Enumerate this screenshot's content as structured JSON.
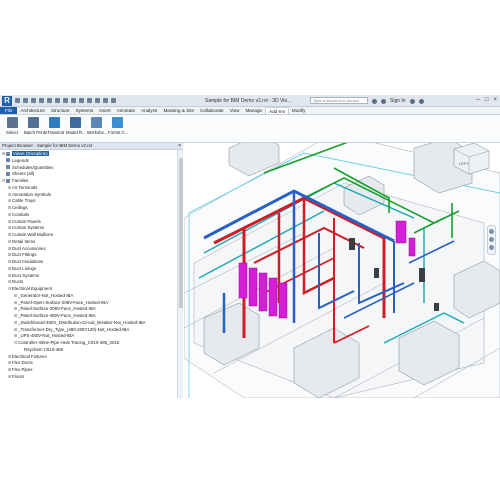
{
  "titlebar": {
    "logo": "R",
    "window_title": "Sample for BIM Demo v2.rvt - 3D Vie...",
    "search_placeholder": "Type a keyword or phrase",
    "sign_in": "Sign In"
  },
  "ribbon_tabs": [
    "File",
    "Architecture",
    "Structure",
    "Systems",
    "Insert",
    "Annotate",
    "Analyze",
    "Massing & Site",
    "Collaborate",
    "View",
    "Manage",
    "Add-Ins",
    "Modify"
  ],
  "active_tab": "Add-Ins",
  "ribbon_buttons": [
    {
      "label": "Select",
      "icon": "cursor-icon",
      "color": "#5d7390"
    },
    {
      "label": "Batch Print",
      "icon": "printer-icon",
      "color": "#4f6f95"
    },
    {
      "label": "eTransmit",
      "icon": "etransmit-icon",
      "color": "#2f7cc0"
    },
    {
      "label": "Model R...",
      "icon": "model-review-icon",
      "color": "#3d6aa0"
    },
    {
      "label": "Workshe...",
      "icon": "worksharing-icon",
      "color": "#5b86b8"
    },
    {
      "label": "FormIt C...",
      "icon": "formit-icon",
      "color": "#3a8fd0"
    }
  ],
  "project_browser": {
    "title": "Project Browser - Sample for BIM Demo v2.rvt",
    "items": [
      {
        "label": "Views (Discipline)",
        "level": 0,
        "toggle": "+",
        "selected": true
      },
      {
        "label": "Legends",
        "level": 0,
        "toggle": "",
        "selected": false
      },
      {
        "label": "Schedules/Quantities",
        "level": 0,
        "toggle": "",
        "selected": false
      },
      {
        "label": "Sheets (all)",
        "level": 0,
        "toggle": "",
        "selected": false
      },
      {
        "label": "Families",
        "level": 0,
        "toggle": "-",
        "selected": false
      },
      {
        "label": "Air Terminals",
        "level": 1,
        "toggle": "+",
        "selected": false
      },
      {
        "label": "Annotation Symbols",
        "level": 1,
        "toggle": "+",
        "selected": false
      },
      {
        "label": "Cable Trays",
        "level": 1,
        "toggle": "+",
        "selected": false
      },
      {
        "label": "Ceilings",
        "level": 1,
        "toggle": "+",
        "selected": false
      },
      {
        "label": "Conduits",
        "level": 1,
        "toggle": "+",
        "selected": false
      },
      {
        "label": "Curtain Panels",
        "level": 1,
        "toggle": "+",
        "selected": false
      },
      {
        "label": "Curtain Systems",
        "level": 1,
        "toggle": "+",
        "selected": false
      },
      {
        "label": "Curtain Wall Mullions",
        "level": 1,
        "toggle": "+",
        "selected": false
      },
      {
        "label": "Detail Items",
        "level": 1,
        "toggle": "+",
        "selected": false
      },
      {
        "label": "Duct Accessories",
        "level": 1,
        "toggle": "+",
        "selected": false
      },
      {
        "label": "Duct Fittings",
        "level": 1,
        "toggle": "+",
        "selected": false
      },
      {
        "label": "Duct Insulations",
        "level": 1,
        "toggle": "+",
        "selected": false
      },
      {
        "label": "Duct Linings",
        "level": 1,
        "toggle": "+",
        "selected": false
      },
      {
        "label": "Duct Systems",
        "level": 1,
        "toggle": "+",
        "selected": false
      },
      {
        "label": "Ducts",
        "level": 1,
        "toggle": "+",
        "selected": false
      },
      {
        "label": "Electrical Equipment",
        "level": 1,
        "toggle": "-",
        "selected": false
      },
      {
        "label": "_Generator-Not_Hosted-IBA",
        "level": 2,
        "toggle": "+",
        "selected": false
      },
      {
        "label": "_Panel-Open-Surface-208V-Face_Hosted-IBA",
        "level": 2,
        "toggle": "+",
        "selected": false
      },
      {
        "label": "_Panel-Surface-208V-Face_Hosted-IBA",
        "level": 2,
        "toggle": "+",
        "selected": false
      },
      {
        "label": "_Panel-Surface-480V-Face_Hosted-IBA",
        "level": 2,
        "toggle": "+",
        "selected": false
      },
      {
        "label": "_Switchboard-480V_Distribution-Circuit_Breaker-Not_Hosted-IBA",
        "level": 2,
        "toggle": "+",
        "selected": false
      },
      {
        "label": "_Transformer-Dry_Type_(480-208Y120)-Not_Hosted-IBA",
        "level": 2,
        "toggle": "+",
        "selected": false
      },
      {
        "label": "_UPS-480V-Not_Hosted-IBA",
        "level": 2,
        "toggle": "+",
        "selected": false
      },
      {
        "label": "Controller-Inline-Pipe Heat Tracing_C910-485_2016",
        "level": 2,
        "toggle": "-",
        "selected": false
      },
      {
        "label": "Raychem C910-485",
        "level": 3,
        "toggle": "",
        "selected": false
      },
      {
        "label": "Electrical Fixtures",
        "level": 1,
        "toggle": "+",
        "selected": false
      },
      {
        "label": "Flex Ducts",
        "level": 1,
        "toggle": "+",
        "selected": false
      },
      {
        "label": "Flex Pipes",
        "level": 1,
        "toggle": "+",
        "selected": false
      },
      {
        "label": "Floors",
        "level": 1,
        "toggle": "+",
        "selected": false
      }
    ]
  },
  "viewcube": {
    "label": "LEFT"
  },
  "colors": {
    "ribbon_accent": "#1f5ea8",
    "duct_red": "#d01c24",
    "duct_blue": "#2a5fc4",
    "pipe_green": "#18a02c",
    "equipment_magenta": "#d51fd6",
    "pipe_teal": "#1aa6b5"
  }
}
